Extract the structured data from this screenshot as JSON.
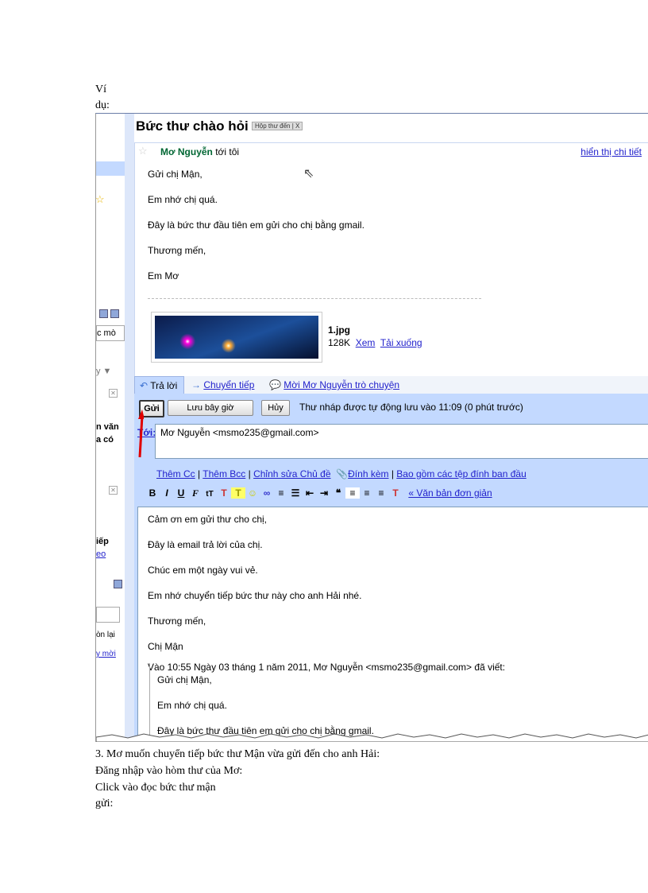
{
  "doc": {
    "label_line1": "Ví",
    "label_line2": "dụ:",
    "caption1": "3. Mơ muốn chuyển tiếp bức thư Mận vừa gửi đến cho anh Hải:",
    "caption2": "Đăng nhập vào hòm thư của Mơ:",
    "caption3": "Click vào đọc bức thư mận",
    "caption4": "gửi:"
  },
  "sidebar": {
    "fragments": [
      "c mò",
      "y ▼",
      "n văn",
      "a có",
      "iếp",
      "eo",
      "òn lại",
      "y mời"
    ]
  },
  "email": {
    "subject": "Bức thư chào hỏi",
    "label_chip": "Hộp thư đến | X",
    "sender_name": "Mơ Nguyễn",
    "sender_suffix": " tới tôi",
    "show_details": "hiển thị chi tiết",
    "body": [
      "Gửi chị Mận,",
      "Em nhớ chị quá.",
      "Đây là bức thư đầu tiên em gửi cho chị bằng gmail.",
      "Thương mến,",
      "Em Mơ"
    ],
    "attachment": {
      "name": "1.jpg",
      "size": "128K",
      "view": "Xem",
      "download": "Tải xuống"
    }
  },
  "actions": {
    "reply": "Trả lời",
    "forward": "Chuyển tiếp",
    "invite": "Mời Mơ Nguyễn trò chuyện"
  },
  "compose": {
    "send": "Gửi",
    "save": "Lưu bây giờ",
    "cancel": "Hủy",
    "draft_status": "Thư nháp được tự động lưu vào 11:09 (0 phút trước)",
    "to_label": "Tới:",
    "to_value": "Mơ Nguyễn <msmo235@gmail.com>",
    "cc_links": [
      "Thêm Cc",
      "Thêm Bcc",
      "Chỉnh sửa Chủ đề",
      "Đính kèm",
      "Bao gồm các tệp đính ban đầu"
    ],
    "plain_text": "« Văn bản đơn giản",
    "reply_body": [
      "Cảm ơn em gửi thư cho chị,",
      "Đây là email trả lời của chị.",
      "Chúc em một ngày vui vẻ.",
      "Em nhớ chuyển tiếp bức thư này cho anh Hải nhé.",
      "Thương mến,",
      "Chị Mận"
    ],
    "quote_header": "Vào 10:55 Ngày 03 tháng 1 năm 2011, Mơ Nguyễn <msmo235@gmail.com> đã viết:",
    "quoted": [
      "Gửi chị Mận,",
      "Em nhớ chị quá.",
      "Đây là bức thư đầu tiên em gửi cho chị bằng gmail."
    ]
  },
  "colors": {
    "accent": "#c3d9ff",
    "link": "#2222cc",
    "sender": "#006633",
    "arrow": "#e00000"
  }
}
